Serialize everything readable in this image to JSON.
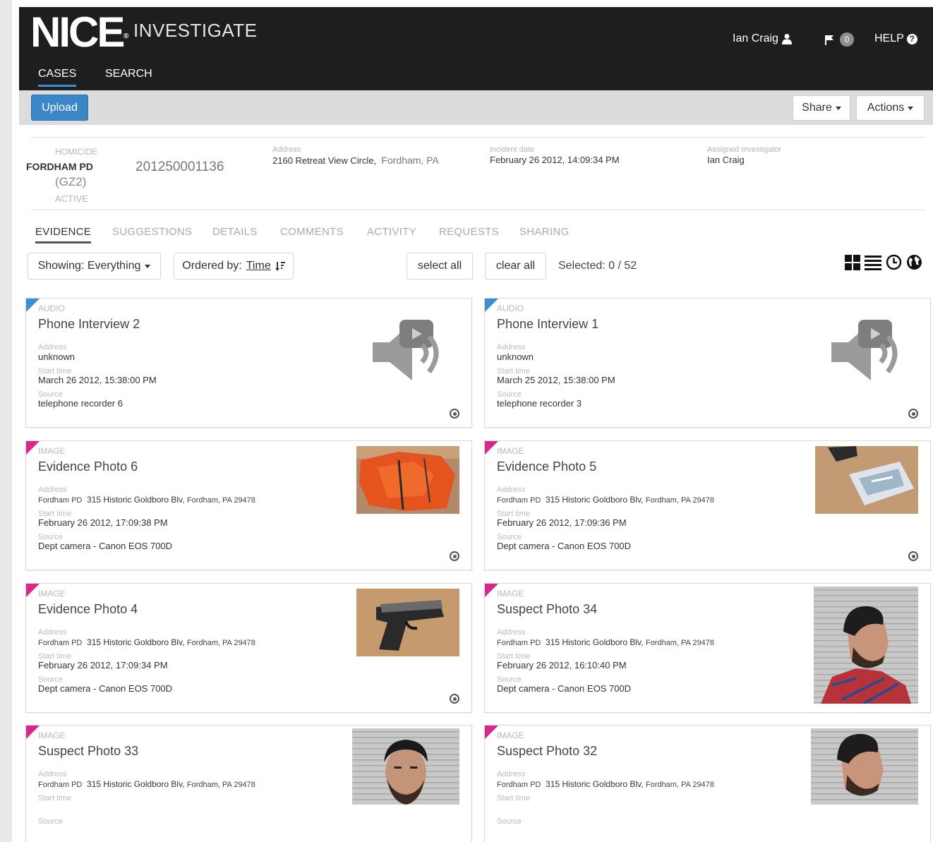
{
  "header": {
    "logo": "NICE",
    "logo_mark": "®",
    "product": "INVESTIGATE",
    "user": "Ian Craig",
    "notifications": "0",
    "help": "HELP",
    "nav": [
      "CASES",
      "SEARCH"
    ]
  },
  "toolbar": {
    "upload": "Upload",
    "share": "Share",
    "actions": "Actions"
  },
  "case": {
    "type": "HOMICIDE",
    "agency": "FORDHAM PD",
    "zone": "(GZ2)",
    "status": "ACTIVE",
    "number": "201250001136",
    "address_label": "Address",
    "address": "2160 Retreat View Circle,",
    "city": "Fordham, PA",
    "incident_label": "Incident date",
    "incident": "February 26 2012, 14:09:34 PM",
    "investigator_label": "Assigned Investigator",
    "investigator": "Ian Craig"
  },
  "tabs": [
    "EVIDENCE",
    "SUGGESTIONS",
    "DETAILS",
    "COMMENTS",
    "ACTIVITY",
    "REQUESTS",
    "SHARING"
  ],
  "filters": {
    "showing": "Showing: Everything",
    "ordered_prefix": "Ordered by:",
    "ordered_value": "Time",
    "select_all": "select all",
    "clear_all": "clear all",
    "selected": "Selected: 0 / 52"
  },
  "labels": {
    "address": "Address",
    "start_time": "Start time",
    "source": "Source"
  },
  "evidence": [
    {
      "type": "AUDIO",
      "title": "Phone Interview 2",
      "address": "unknown",
      "start": "March 26 2012, 15:38:00 PM",
      "source": "telephone recorder 6"
    },
    {
      "type": "AUDIO",
      "title": "Phone Interview 1",
      "address": "unknown",
      "start": "March 25 2012, 15:38:00 PM",
      "source": "telephone recorder 3"
    },
    {
      "type": "IMAGE",
      "title": "Evidence Photo 6",
      "agency": "Fordham PD",
      "street": "315 Historic Goldboro Blv,",
      "locality": "Fordham, PA 29478",
      "start": "February 26 2012, 17:09:38 PM",
      "source": "Dept camera - Canon EOS 700D"
    },
    {
      "type": "IMAGE",
      "title": "Evidence Photo 5",
      "agency": "Fordham PD",
      "street": "315 Historic Goldboro Blv,",
      "locality": "Fordham, PA 29478",
      "start": "February 26 2012, 17:09:36 PM",
      "source": "Dept camera - Canon EOS 700D"
    },
    {
      "type": "IMAGE",
      "title": "Evidence Photo 4",
      "agency": "Fordham PD",
      "street": "315 Historic Goldboro Blv,",
      "locality": "Fordham, PA 29478",
      "start": "February 26 2012, 17:09:34 PM",
      "source": "Dept camera - Canon EOS 700D"
    },
    {
      "type": "IMAGE",
      "title": "Suspect Photo 34",
      "agency": "Fordham PD",
      "street": "315 Historic Goldboro Blv,",
      "locality": "Fordham, PA 29478",
      "start": "February 26 2012, 16:10:40 PM",
      "source": "Dept camera - Canon EOS 700D"
    },
    {
      "type": "IMAGE",
      "title": "Suspect Photo 33",
      "agency": "Fordham PD",
      "street": "315 Historic Goldboro Blv,",
      "locality": "Fordham, PA 29478",
      "start": "",
      "source": ""
    },
    {
      "type": "IMAGE",
      "title": "Suspect Photo 32",
      "agency": "Fordham PD",
      "street": "315 Historic Goldboro Blv,",
      "locality": "Fordham, PA 29478",
      "start": "",
      "source": ""
    }
  ],
  "colors": {
    "header_bg": "#1e1e1e",
    "accent_blue": "#3b86c7",
    "audio_marker": "#3d8fd1",
    "image_marker": "#d8288c"
  },
  "icons": [
    "user-icon",
    "flag-icon",
    "help-icon",
    "grid-view-icon",
    "list-view-icon",
    "timeline-view-icon",
    "map-view-icon",
    "speaker-icon",
    "target-icon",
    "sort-icon"
  ]
}
